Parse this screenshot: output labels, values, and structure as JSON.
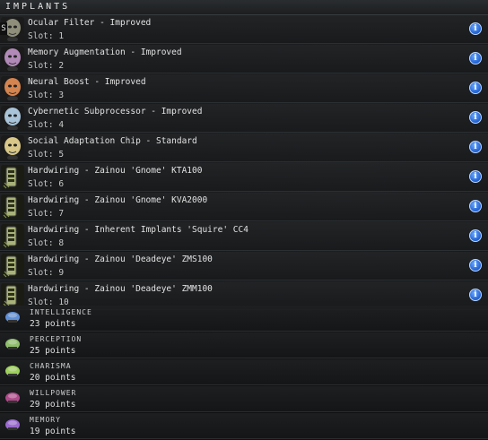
{
  "header": {
    "title": "IMPLANTS"
  },
  "slot_marker": "S",
  "implants": [
    {
      "name": "Ocular Filter - Improved",
      "slot": "Slot: 1",
      "icon": "ocular-filter-icon",
      "color": "#8e8e7a"
    },
    {
      "name": "Memory Augmentation - Improved",
      "slot": "Slot: 2",
      "icon": "memory-augmentation-icon",
      "color": "#b28ab8"
    },
    {
      "name": "Neural Boost - Improved",
      "slot": "Slot: 3",
      "icon": "neural-boost-icon",
      "color": "#d4844f"
    },
    {
      "name": "Cybernetic Subprocessor - Improved",
      "slot": "Slot: 4",
      "icon": "cybernetic-subprocessor-icon",
      "color": "#a9c4d8"
    },
    {
      "name": "Social Adaptation Chip - Standard",
      "slot": "Slot: 5",
      "icon": "social-adaptation-icon",
      "color": "#d8c788"
    },
    {
      "name": "Hardwiring - Zainou 'Gnome' KTA100",
      "slot": "Slot: 6",
      "icon": "hardwiring-icon",
      "color": "#a9b27a"
    },
    {
      "name": "Hardwiring - Zainou 'Gnome' KVA2000",
      "slot": "Slot: 7",
      "icon": "hardwiring-icon",
      "color": "#a9b27a"
    },
    {
      "name": "Hardwiring - Inherent Implants 'Squire' CC4",
      "slot": "Slot: 8",
      "icon": "hardwiring-icon",
      "color": "#a9b27a"
    },
    {
      "name": "Hardwiring - Zainou 'Deadeye' ZMS100",
      "slot": "Slot: 9",
      "icon": "hardwiring-icon",
      "color": "#a9b27a"
    },
    {
      "name": "Hardwiring - Zainou 'Deadeye' ZMM100",
      "slot": "Slot: 10",
      "icon": "hardwiring-icon",
      "color": "#a9b27a"
    }
  ],
  "info_glyph": "i",
  "attributes": [
    {
      "name": "INTELLIGENCE",
      "points": "23 points",
      "icon": "intelligence-icon",
      "color": "#5f8fd6"
    },
    {
      "name": "PERCEPTION",
      "points": "25 points",
      "icon": "perception-icon",
      "color": "#8fbf6a"
    },
    {
      "name": "CHARISMA",
      "points": "20 points",
      "icon": "charisma-icon",
      "color": "#9ed05c"
    },
    {
      "name": "WILLPOWER",
      "points": "29 points",
      "icon": "willpower-icon",
      "color": "#b04a8a"
    },
    {
      "name": "MEMORY",
      "points": "19 points",
      "icon": "memory-icon",
      "color": "#9a6ad0"
    }
  ]
}
